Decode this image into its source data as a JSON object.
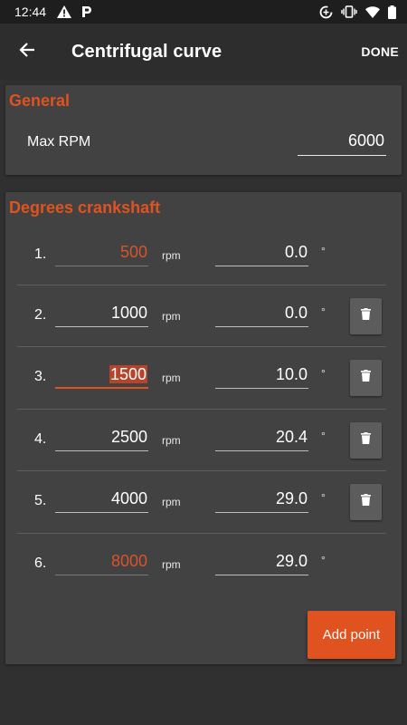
{
  "status_bar": {
    "time": "12:44",
    "left_icons": [
      "warning-icon",
      "parking-icon"
    ],
    "right_icons": [
      "data-saver-icon",
      "vibrate-icon",
      "wifi-icon",
      "battery-icon"
    ]
  },
  "app_bar": {
    "title": "Centrifugal curve",
    "action": "DONE",
    "back_icon": "arrow-back-icon"
  },
  "general": {
    "title": "General",
    "max_rpm_label": "Max RPM",
    "max_rpm_value": "6000"
  },
  "degrees": {
    "title": "Degrees crankshaft",
    "rpm_unit": "rpm",
    "deg_unit": "°",
    "rows": [
      {
        "num": "1.",
        "rpm": "500",
        "deg": "0.0"
      },
      {
        "num": "2.",
        "rpm": "1000",
        "deg": "0.0"
      },
      {
        "num": "3.",
        "rpm": "1500",
        "deg": "10.0"
      },
      {
        "num": "4.",
        "rpm": "2500",
        "deg": "20.4"
      },
      {
        "num": "5.",
        "rpm": "4000",
        "deg": "29.0"
      },
      {
        "num": "6.",
        "rpm": "8000",
        "deg": "29.0"
      }
    ],
    "add_button": "Add point"
  },
  "colors": {
    "accent": "#e0521f",
    "background": "#303030",
    "card": "#424242"
  }
}
